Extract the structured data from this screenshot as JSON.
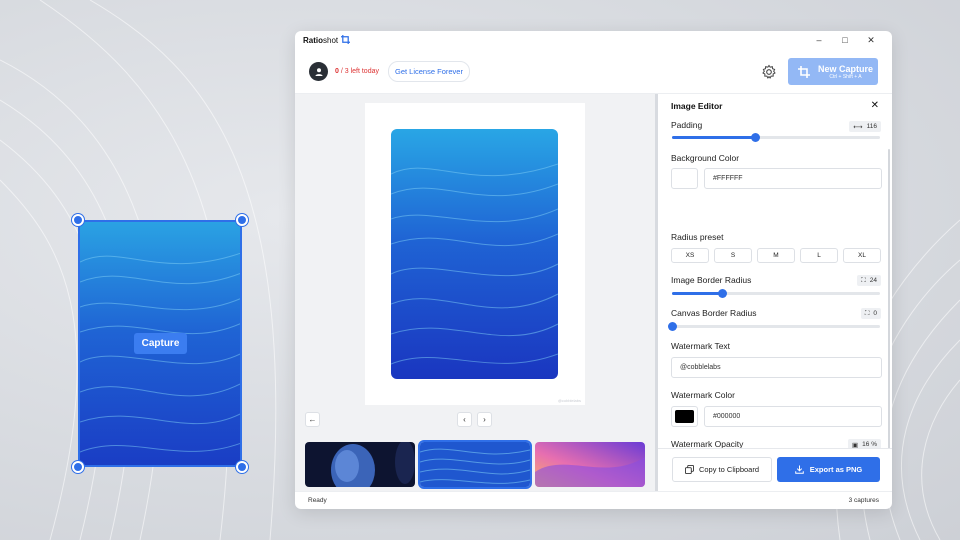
{
  "app": {
    "brand_bold": "Ratio",
    "brand_light": "shot",
    "minimize": "–",
    "maximize": "□",
    "close": "✕"
  },
  "capture_overlay": {
    "button_label": "Capture"
  },
  "toolbar": {
    "count_used": "0",
    "count_rest": " / 3 left today",
    "license_label": "Get License Forever",
    "new_capture_label": "New Capture",
    "new_capture_shortcut": "Ctrl + Shift + A"
  },
  "canvas": {
    "watermark": "@cobblelabs"
  },
  "nav": {
    "back": "←",
    "prev": "‹",
    "next": "›"
  },
  "editor": {
    "title": "Image Editor",
    "close": "✕",
    "padding": {
      "label": "Padding",
      "value": "116",
      "level": 0.4
    },
    "background_color": {
      "label": "Background Color",
      "value": "#FFFFFF"
    },
    "radius_preset": {
      "label": "Radius preset",
      "options": [
        "XS",
        "S",
        "M",
        "L",
        "XL"
      ]
    },
    "image_border_radius": {
      "label": "Image Border Radius",
      "value": "24",
      "level": 0.24
    },
    "canvas_border_radius": {
      "label": "Canvas Border Radius",
      "value": "0",
      "level": 0
    },
    "watermark_text": {
      "label": "Watermark Text",
      "value": "@cobblelabs"
    },
    "watermark_color": {
      "label": "Watermark Color",
      "value": "#000000"
    },
    "watermark_opacity": {
      "label": "Watermark Opacity",
      "value": "16 %",
      "level": 0.16
    },
    "copy_label": "Copy to Clipboard",
    "export_label": "Export as PNG"
  },
  "status": {
    "left": "Ready",
    "right": "3 captures"
  },
  "colors": {
    "accent": "#2f6fe8",
    "accent_light": "#93b8f5",
    "count_red": "#dd3333"
  }
}
